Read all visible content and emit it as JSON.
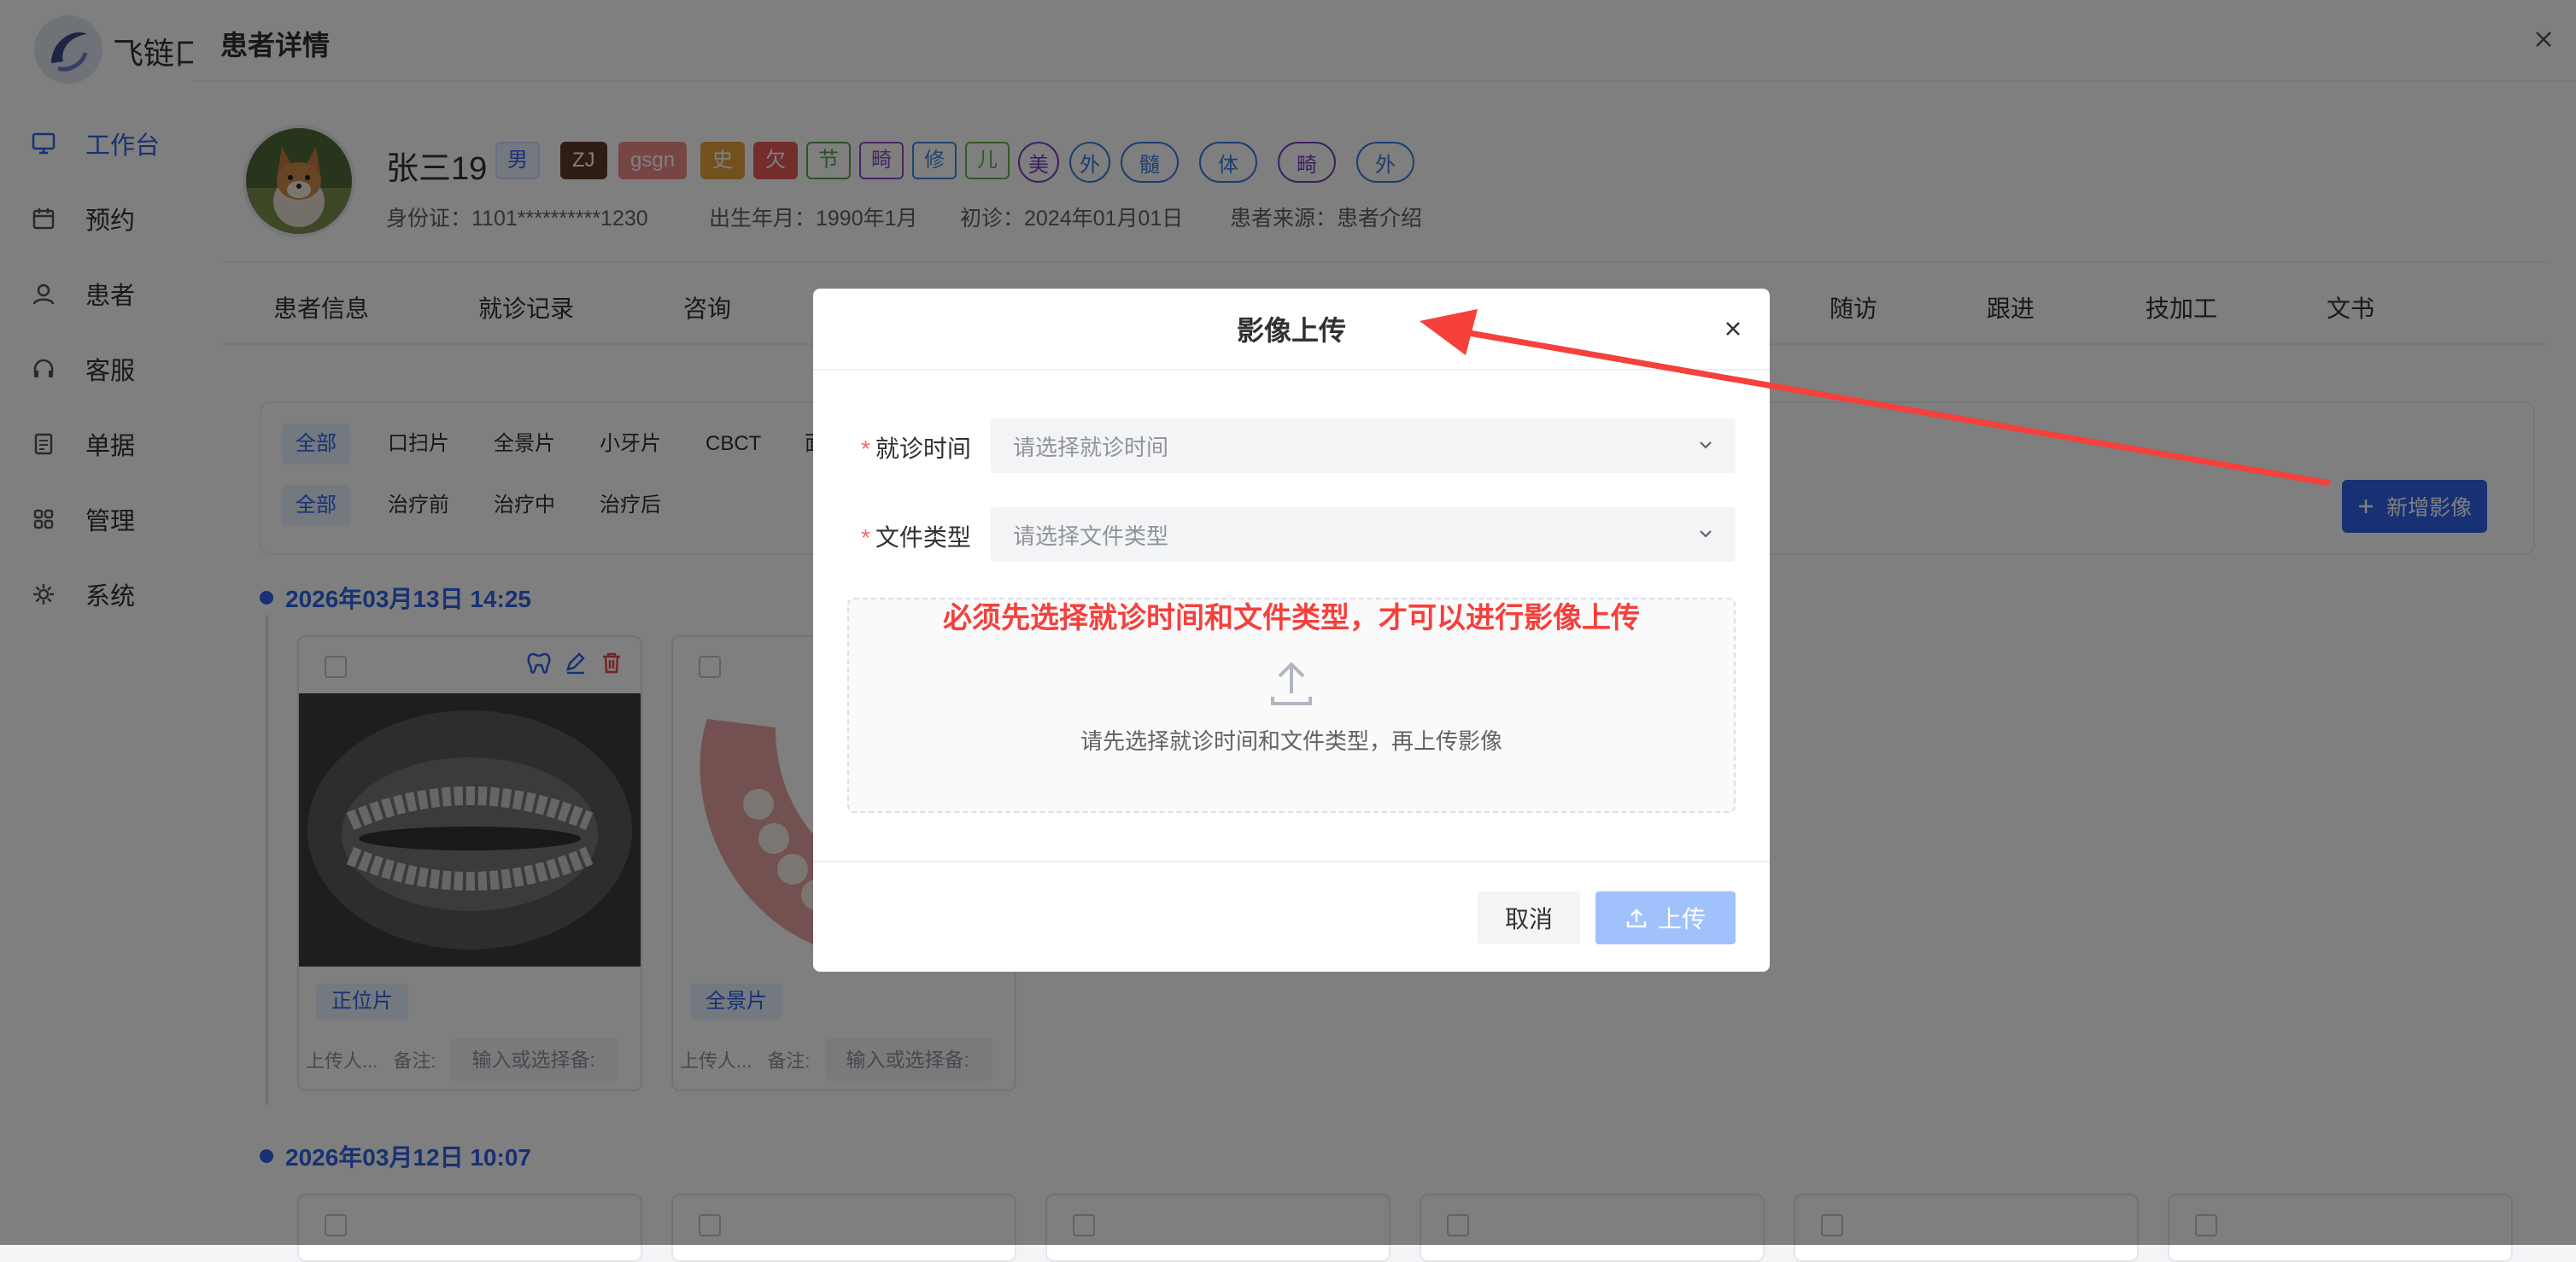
{
  "app": {
    "brand": "飞链口"
  },
  "sidebar": {
    "items": [
      {
        "label": "工作台",
        "icon": "monitor-icon"
      },
      {
        "label": "预约",
        "icon": "calendar-icon"
      },
      {
        "label": "患者",
        "icon": "user-icon"
      },
      {
        "label": "客服",
        "icon": "headset-icon"
      },
      {
        "label": "单据",
        "icon": "document-icon"
      },
      {
        "label": "管理",
        "icon": "grid-icon"
      },
      {
        "label": "系统",
        "icon": "gear-icon"
      }
    ]
  },
  "drawer": {
    "title": "患者详情"
  },
  "patient": {
    "name": "张三19",
    "gender": "男",
    "tags": [
      "ZJ",
      "gsgn",
      "史",
      "欠",
      "节",
      "畸",
      "修",
      "儿"
    ],
    "circle_tags": [
      "美",
      "外"
    ],
    "pill_tags": [
      "髓",
      "体",
      "畸",
      "外"
    ],
    "id_label": "身份证：1101**********1230",
    "birth": "出生年月：1990年1月",
    "first_visit": "初诊：2024年01月01日",
    "source": "患者来源：患者介绍"
  },
  "tabs": [
    "患者信息",
    "就诊记录",
    "咨询",
    "随访",
    "跟进",
    "技加工",
    "文书"
  ],
  "filters": {
    "types": [
      "全部",
      "口扫片",
      "全景片",
      "小牙片",
      "CBCT",
      "面"
    ],
    "stages": [
      "全部",
      "治疗前",
      "治疗中",
      "治疗后"
    ],
    "add_button": "新增影像"
  },
  "groups": [
    {
      "date": "2026年03月13日 14:25",
      "cards": [
        {
          "tag": "正位片",
          "uploader": "上传人...",
          "memo_label": "备注:",
          "memo_placeholder": "输入或选择备:"
        },
        {
          "tag": "全景片",
          "uploader": "上传人...",
          "memo_label": "备注:",
          "memo_placeholder": "输入或选择备:"
        }
      ]
    },
    {
      "date": "2026年03月12日 10:07"
    }
  ],
  "modal": {
    "title": "影像上传",
    "visit_time_label": "就诊时间",
    "visit_time_placeholder": "请选择就诊时间",
    "file_type_label": "文件类型",
    "file_type_placeholder": "请选择文件类型",
    "upload_hint": "请先选择就诊时间和文件类型，再上传影像",
    "annotation": "必须先选择就诊时间和文件类型，才可以进行影像上传",
    "cancel": "取消",
    "upload": "上传"
  },
  "colors": {
    "primary": "#2e63e8",
    "annotation_red": "#f5403c",
    "required": "#f56c6c"
  }
}
